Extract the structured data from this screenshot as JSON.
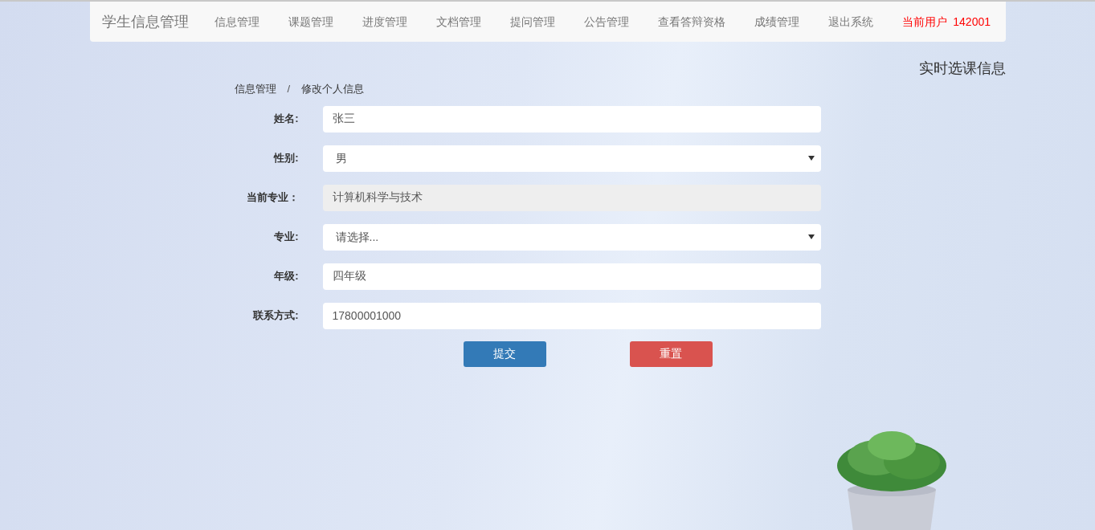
{
  "navbar": {
    "brand": "学生信息管理",
    "items": [
      {
        "label": "信息管理",
        "kind": "link"
      },
      {
        "label": "课题管理",
        "kind": "link"
      },
      {
        "label": "进度管理",
        "kind": "link"
      },
      {
        "label": "文档管理",
        "kind": "link"
      },
      {
        "label": "提问管理",
        "kind": "link"
      },
      {
        "label": "公告管理",
        "kind": "link"
      },
      {
        "label": "查看答辩资格",
        "kind": "link"
      },
      {
        "label": "成绩管理",
        "kind": "link"
      },
      {
        "label": "退出系统",
        "kind": "link"
      },
      {
        "label": "当前用户  142001",
        "kind": "user"
      }
    ]
  },
  "side_title": "实时选课信息",
  "breadcrumb": [
    "信息管理",
    "修改个人信息"
  ],
  "breadcrumb_separator": "/",
  "form": {
    "fields": [
      {
        "label": "姓名:",
        "kind": "text",
        "value": "张三"
      },
      {
        "label": "性别:",
        "kind": "select",
        "value": "男"
      },
      {
        "label": "当前专业：",
        "kind": "readonly",
        "value": "计算机科学与技术"
      },
      {
        "label": "专业:",
        "kind": "select",
        "value": "请选择..."
      },
      {
        "label": "年级:",
        "kind": "text",
        "value": "四年级"
      },
      {
        "label": "联系方式:",
        "kind": "text",
        "value": "17800001000"
      }
    ],
    "buttons": [
      {
        "label": "提交",
        "kind": "primary"
      },
      {
        "label": "重置",
        "kind": "danger"
      }
    ]
  }
}
